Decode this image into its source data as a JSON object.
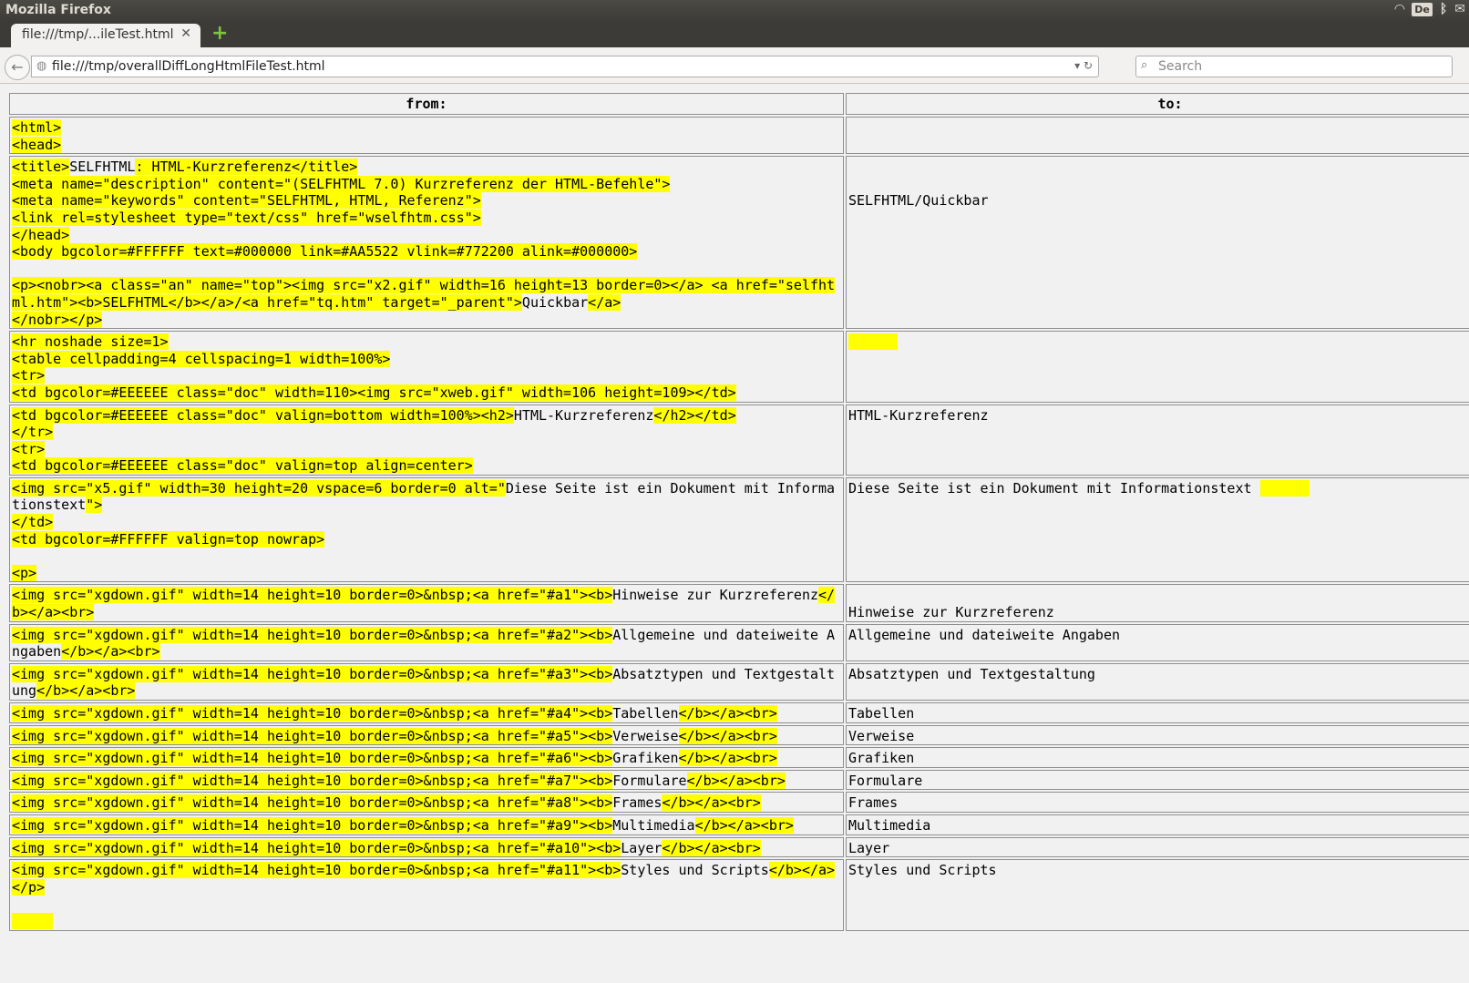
{
  "window": {
    "title": "Mozilla Firefox",
    "keyboard_layout": "De"
  },
  "tab": {
    "label": "file:///tmp/...ileTest.html",
    "close": "✕"
  },
  "navbar": {
    "url": "file:///tmp/overallDiffLongHtmlFileTest.html",
    "search_placeholder": "Search"
  },
  "diff": {
    "headers": {
      "from": "from:",
      "to": "to:"
    },
    "highlight_color": "#ffff00",
    "rows": [
      {
        "from": [
          [
            {
              "t": "<html>",
              "h": 1
            }
          ],
          [
            {
              "t": "<head>",
              "h": 1
            }
          ]
        ],
        "to": []
      },
      {
        "from": [
          [
            {
              "t": "<title>",
              "h": 1
            },
            {
              "t": "SELFHTML",
              "h": 0
            },
            {
              "t": ": HTML-Kurzreferenz</title>",
              "h": 1
            }
          ],
          [
            {
              "t": "<meta name=\"description\" content=\"(SELFHTML 7.0) Kurzreferenz der HTML-Befehle\">",
              "h": 1
            }
          ],
          [
            {
              "t": "<meta name=\"keywords\" content=\"SELFHTML, HTML, Referenz\">",
              "h": 1
            }
          ],
          [
            {
              "t": "<link rel=stylesheet type=\"text/css\" href=\"wselfhtm.css\">",
              "h": 1
            }
          ],
          [
            {
              "t": "</head>",
              "h": 1
            }
          ],
          [
            {
              "t": "<body bgcolor=#FFFFFF text=#000000 link=#AA5522 vlink=#772200 alink=#000000>",
              "h": 1
            }
          ],
          [
            {
              "t": "",
              "h": 0
            }
          ],
          [
            {
              "t": "<p><nobr><a class=\"an\" name=\"top\"><img src=\"x2.gif\" width=16 height=13 border=0></a> <a href=\"selfhtml.htm\"><b>SELFHTML</b></a>/<a href=\"tq.htm\" target=\"_parent\">",
              "h": 1
            },
            {
              "t": "Quickbar",
              "h": 0
            },
            {
              "t": "</a>",
              "h": 1
            }
          ],
          [
            {
              "t": "</nobr></p>",
              "h": 1
            }
          ]
        ],
        "to": [
          [
            {
              "t": "",
              "h": 0
            }
          ],
          [
            {
              "t": "",
              "h": 0
            }
          ],
          [
            {
              "t": "SELFHTML/Quickbar",
              "h": 0
            }
          ]
        ]
      },
      {
        "from": [
          [
            {
              "t": "<hr noshade size=1>",
              "h": 1
            }
          ],
          [
            {
              "t": "<table cellpadding=4 cellspacing=1 width=100%>",
              "h": 1
            }
          ],
          [
            {
              "t": "<tr>",
              "h": 1
            }
          ],
          [
            {
              "t": "<td bgcolor=#EEEEEE class=\"doc\" width=110><img src=\"xweb.gif\" width=106 height=109></td>",
              "h": 1
            }
          ]
        ],
        "to": [
          [
            {
              "t": "      ",
              "h": 1
            }
          ]
        ]
      },
      {
        "from": [
          [
            {
              "t": "<td bgcolor=#EEEEEE class=\"doc\" valign=bottom width=100%><h2>",
              "h": 1
            },
            {
              "t": "HTML-Kurzreferenz",
              "h": 0
            },
            {
              "t": "</h2></td>",
              "h": 1
            }
          ],
          [
            {
              "t": "</tr>",
              "h": 1
            }
          ],
          [
            {
              "t": "<tr>",
              "h": 1
            }
          ],
          [
            {
              "t": "<td bgcolor=#EEEEEE class=\"doc\" valign=top align=center>",
              "h": 1
            }
          ]
        ],
        "to": [
          [
            {
              "t": "HTML-Kurzreferenz",
              "h": 0
            }
          ]
        ]
      },
      {
        "from": [
          [
            {
              "t": "<img src=\"x5.gif\" width=30 height=20 vspace=6 border=0 alt=\"",
              "h": 1
            },
            {
              "t": "Diese Seite ist ein Dokument mit Informationstext",
              "h": 0
            },
            {
              "t": "\">",
              "h": 1
            }
          ],
          [
            {
              "t": "</td>",
              "h": 1
            }
          ],
          [
            {
              "t": "<td ",
              "h": 1
            },
            {
              "t": "bgcolor=#FFFFFF valign=top nowrap>",
              "h": 1
            }
          ],
          [
            {
              "t": "",
              "h": 0
            }
          ],
          [
            {
              "t": "<p>",
              "h": 1
            }
          ]
        ],
        "to": [
          [
            {
              "t": "Diese Seite ist ein Dokument mit Informationstext ",
              "h": 0
            },
            {
              "t": "      ",
              "h": 1
            }
          ]
        ]
      },
      {
        "from": [
          [
            {
              "t": "<img ",
              "h": 1
            },
            {
              "t": "src=\"xgdown.gif\" width=14 height=10 border=0>&nbsp;<a href=\"#a1\"><b>",
              "h": 1
            },
            {
              "t": "Hinweise zur Kurzreferenz",
              "h": 0
            },
            {
              "t": "</b></a><br>",
              "h": 1
            }
          ]
        ],
        "to": [
          [
            {
              "t": "",
              "h": 0
            }
          ],
          [
            {
              "t": "Hinweise zur Kurzreferenz",
              "h": 0
            }
          ]
        ]
      },
      {
        "from": [
          [
            {
              "t": "<img ",
              "h": 1
            },
            {
              "t": "src=\"xgdown.gif\" width=14 height=10 border=0>&nbsp;<a href=\"#a2\"><b>",
              "h": 1
            },
            {
              "t": "Allgemeine und dateiweite Angaben",
              "h": 0
            },
            {
              "t": "</b></a><br>",
              "h": 1
            }
          ]
        ],
        "to": [
          [
            {
              "t": "Allgemeine und dateiweite Angaben",
              "h": 0
            }
          ]
        ]
      },
      {
        "from": [
          [
            {
              "t": "<img ",
              "h": 1
            },
            {
              "t": "src=\"xgdown.gif\" width=14 height=10 border=0>&nbsp;<a href=\"#a3\"><b>",
              "h": 1
            },
            {
              "t": "Absatztypen und Textgestaltung",
              "h": 0
            },
            {
              "t": "</b></a><br>",
              "h": 1
            }
          ]
        ],
        "to": [
          [
            {
              "t": "Absatztypen und Textgestaltung",
              "h": 0
            }
          ]
        ]
      },
      {
        "from": [
          [
            {
              "t": "<img ",
              "h": 1
            },
            {
              "t": "src=\"xgdown.gif\" width=14 height=10 border=0>&nbsp;<a href=\"#a4\"><b>",
              "h": 1
            },
            {
              "t": "Tabellen",
              "h": 0
            },
            {
              "t": "</b></a><br>",
              "h": 1
            }
          ]
        ],
        "to": [
          [
            {
              "t": "Tabellen",
              "h": 0
            }
          ]
        ]
      },
      {
        "from": [
          [
            {
              "t": "<img ",
              "h": 1
            },
            {
              "t": "src=\"xgdown.gif\" width=14 height=10 border=0>&nbsp;<a href=\"#a5\"><b>",
              "h": 1
            },
            {
              "t": "Verweise",
              "h": 0
            },
            {
              "t": "</b></a><br>",
              "h": 1
            }
          ]
        ],
        "to": [
          [
            {
              "t": "Verweise",
              "h": 0
            }
          ]
        ]
      },
      {
        "from": [
          [
            {
              "t": "<img ",
              "h": 1
            },
            {
              "t": "src=\"xgdown.gif\" width=14 height=10 border=0>&nbsp;<a href=\"#a6\"><b>",
              "h": 1
            },
            {
              "t": "Grafiken",
              "h": 0
            },
            {
              "t": "</b></a><br>",
              "h": 1
            }
          ]
        ],
        "to": [
          [
            {
              "t": "Grafiken",
              "h": 0
            }
          ]
        ]
      },
      {
        "from": [
          [
            {
              "t": "<img ",
              "h": 1
            },
            {
              "t": "src=\"xgdown.gif\" width=14 height=10 border=0>&nbsp;<a href=\"#a7\"><b>",
              "h": 1
            },
            {
              "t": "Formulare",
              "h": 0
            },
            {
              "t": "</b></a><br>",
              "h": 1
            }
          ]
        ],
        "to": [
          [
            {
              "t": "Formulare",
              "h": 0
            }
          ]
        ]
      },
      {
        "from": [
          [
            {
              "t": "<img ",
              "h": 1
            },
            {
              "t": "src=\"xgdown.gif\" width=14 height=10 border=0>&nbsp;<a href=\"#a8\"><b>",
              "h": 1
            },
            {
              "t": "Frames",
              "h": 0
            },
            {
              "t": "</b></a><br>",
              "h": 1
            }
          ]
        ],
        "to": [
          [
            {
              "t": "Frames",
              "h": 0
            }
          ]
        ]
      },
      {
        "from": [
          [
            {
              "t": "<img ",
              "h": 1
            },
            {
              "t": "src=\"xgdown.gif\" width=14 height=10 border=0>&nbsp;<a href=\"#a9\"><b>",
              "h": 1
            },
            {
              "t": "Multimedia",
              "h": 0
            },
            {
              "t": "</b></a><br>",
              "h": 1
            }
          ]
        ],
        "to": [
          [
            {
              "t": "Multimedia",
              "h": 0
            }
          ]
        ]
      },
      {
        "from": [
          [
            {
              "t": "<img ",
              "h": 1
            },
            {
              "t": "src=\"xgdown.gif\" width=14 height=10 border=0>&nbsp;<a href=\"#a10\"><b>",
              "h": 1
            },
            {
              "t": "Layer",
              "h": 0
            },
            {
              "t": "</b></a><br>",
              "h": 1
            }
          ]
        ],
        "to": [
          [
            {
              "t": "Layer",
              "h": 0
            }
          ]
        ]
      },
      {
        "from": [
          [
            {
              "t": "<img ",
              "h": 1
            },
            {
              "t": "src=\"xgdown.gif\" width=14 height=10 border=0>&nbsp;<a href=\"#a11\"><b>",
              "h": 1
            },
            {
              "t": "Styles und Scripts",
              "h": 0
            },
            {
              "t": "</b></a>",
              "h": 1
            }
          ],
          [
            {
              "t": "</p>",
              "h": 1
            }
          ],
          [
            {
              "t": "",
              "h": 0
            }
          ],
          [
            {
              "t": "     ",
              "h": 1
            }
          ]
        ],
        "to": [
          [
            {
              "t": "Styles und Scripts",
              "h": 0
            }
          ]
        ]
      }
    ]
  }
}
